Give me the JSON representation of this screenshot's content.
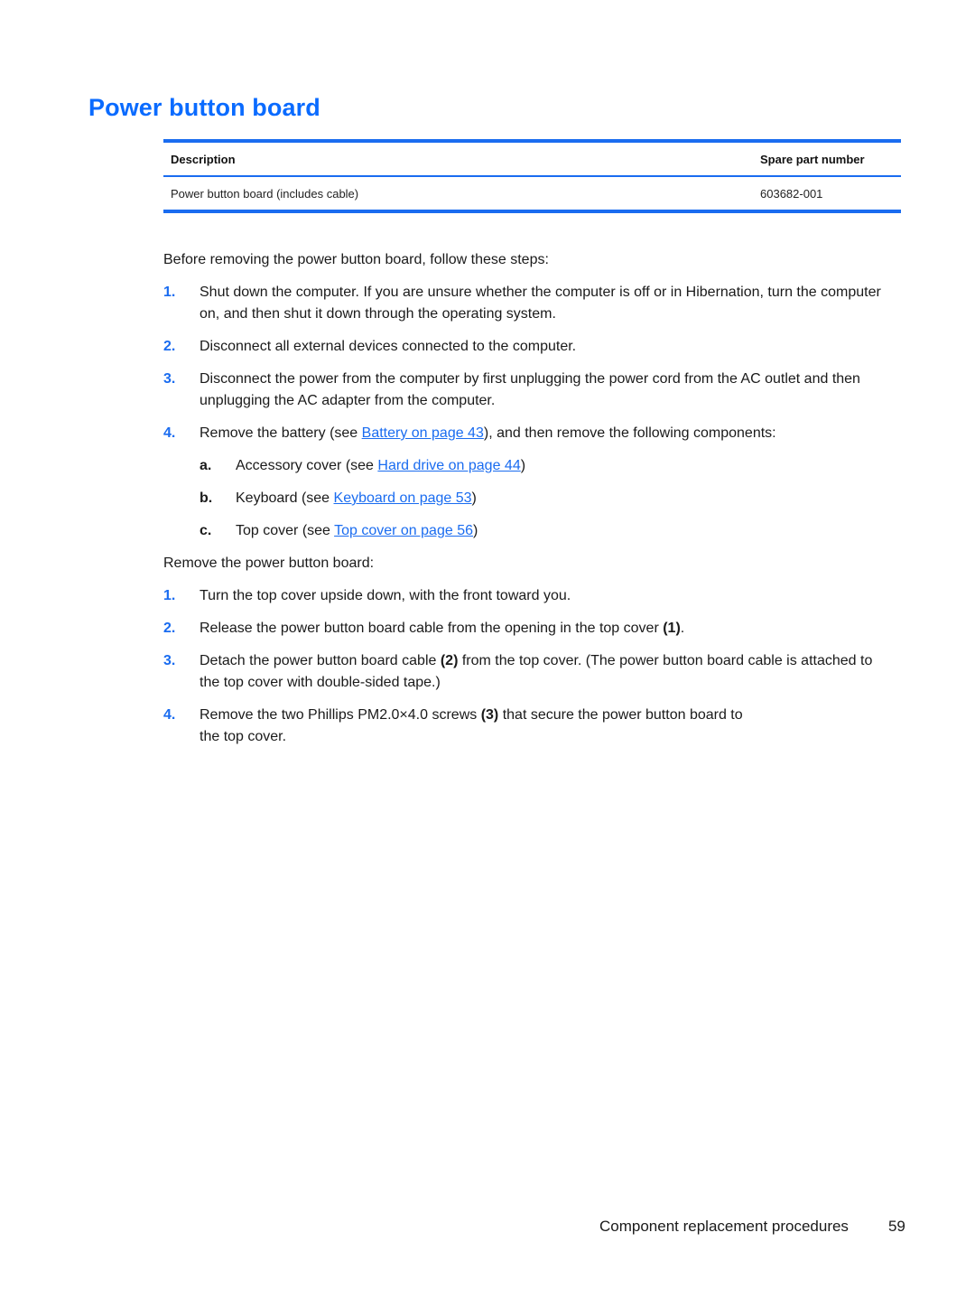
{
  "page": {
    "title": "Power button board"
  },
  "table": {
    "headers": {
      "description": "Description",
      "part_number": "Spare part number"
    },
    "rows": [
      {
        "description": "Power button board (includes cable)",
        "part_number": "603682-001"
      }
    ]
  },
  "preparation": {
    "intro": "Before removing the power button board, follow these steps:",
    "steps": [
      {
        "num": "1.",
        "text": "Shut down the computer. If you are unsure whether the computer is off or in Hibernation, turn the computer on, and then shut it down through the operating system."
      },
      {
        "num": "2.",
        "text": "Disconnect all external devices connected to the computer."
      },
      {
        "num": "3.",
        "text": "Disconnect the power from the computer by first unplugging the power cord from the AC outlet and then unplugging the AC adapter from the computer."
      },
      {
        "num": "4.",
        "text_before": "Remove the battery (see ",
        "link": "Battery on page 43",
        "text_after": "), and then remove the following components:",
        "substeps": [
          {
            "letter": "a.",
            "text_before": "Accessory cover (see ",
            "link": "Hard drive on page 44",
            "text_after": ")"
          },
          {
            "letter": "b.",
            "text_before": "Keyboard (see ",
            "link": "Keyboard on page 53",
            "text_after": ")"
          },
          {
            "letter": "c.",
            "text_before": "Top cover (see ",
            "link": "Top cover on page 56",
            "text_after": ")"
          }
        ]
      }
    ]
  },
  "removal": {
    "intro": "Remove the power button board:",
    "steps": [
      {
        "num": "1.",
        "text": "Turn the top cover upside down, with the front toward you."
      },
      {
        "num": "2.",
        "text_before": "Release the power button board cable from the opening in the top cover ",
        "callout": "(1)",
        "text_after": "."
      },
      {
        "num": "3.",
        "text_before": "Detach the power button board cable ",
        "callout": "(2)",
        "text_after": " from the top cover. (The power button board cable is attached to the top cover with double-sided tape.)"
      },
      {
        "num": "4.",
        "text_before": "Remove the two Phillips PM2.0×4.0 screws ",
        "callout": "(3)",
        "text_after": " that secure the power button board to",
        "text_line2": "the top cover."
      }
    ]
  },
  "footer": {
    "section": "Component replacement procedures",
    "page_number": "59"
  },
  "colors": {
    "accent": "#1a6cf0",
    "heading": "#0a6bff",
    "text": "#1a1a1a"
  }
}
